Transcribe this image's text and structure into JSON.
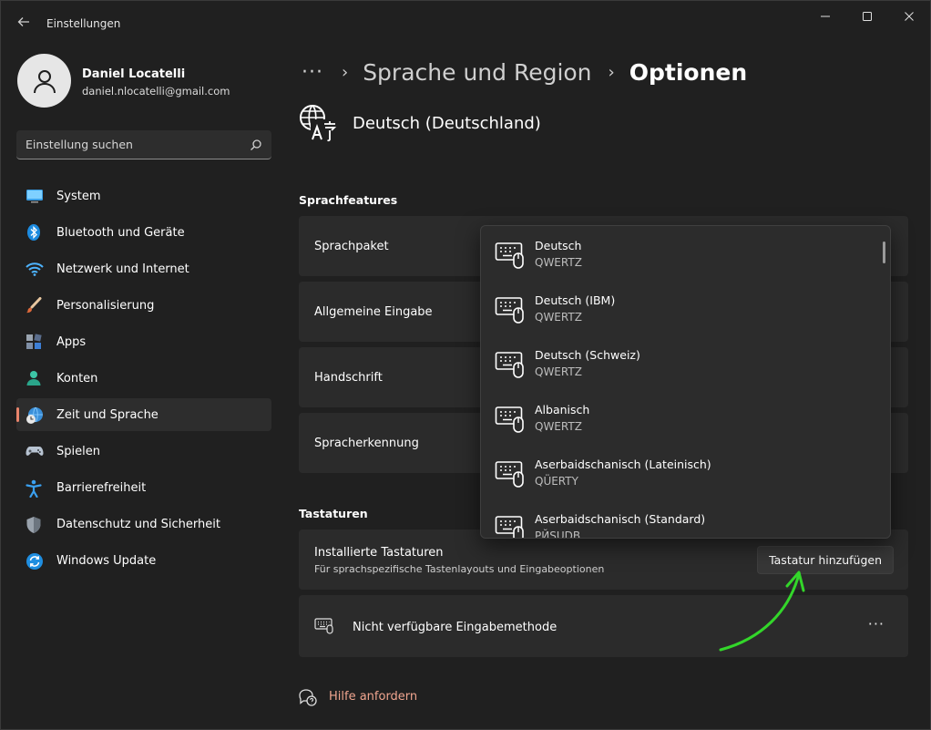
{
  "window": {
    "title": "Einstellungen",
    "controls": [
      "minimize-icon",
      "maximize-icon",
      "close-icon"
    ]
  },
  "profile": {
    "name": "Daniel Locatelli",
    "email": "daniel.nlocatelli@gmail.com"
  },
  "search": {
    "placeholder": "Einstellung suchen"
  },
  "nav": {
    "active": "Zeit und Sprache",
    "items": [
      {
        "label": "System",
        "icon": "monitor-icon"
      },
      {
        "label": "Bluetooth und Geräte",
        "icon": "bluetooth-icon"
      },
      {
        "label": "Netzwerk und Internet",
        "icon": "wifi-icon"
      },
      {
        "label": "Personalisierung",
        "icon": "brush-icon"
      },
      {
        "label": "Apps",
        "icon": "apps-icon"
      },
      {
        "label": "Konten",
        "icon": "person-icon"
      },
      {
        "label": "Zeit und Sprache",
        "icon": "clock-globe-icon"
      },
      {
        "label": "Spielen",
        "icon": "gamepad-icon"
      },
      {
        "label": "Barrierefreiheit",
        "icon": "accessibility-icon"
      },
      {
        "label": "Datenschutz und Sicherheit",
        "icon": "shield-icon"
      },
      {
        "label": "Windows Update",
        "icon": "update-icon"
      }
    ]
  },
  "breadcrumb": {
    "parent": "Sprache und Region",
    "current": "Optionen"
  },
  "language": {
    "title": "Deutsch (Deutschland)"
  },
  "sprachfeatures": {
    "title": "Sprachfeatures",
    "items": [
      "Sprachpaket",
      "Allgemeine Eingabe",
      "Handschrift",
      "Spracherkennung"
    ]
  },
  "tastaturen": {
    "title": "Tastaturen",
    "installed_label": "Installierte Tastaturen",
    "installed_sub": "Für sprachspezifische Tastenlayouts und Eingabeoptionen",
    "add_button": "Tastatur hinzufügen",
    "unavailable_label": "Nicht verfügbare Eingabemethode",
    "more": "···"
  },
  "help": {
    "label": "Hilfe anfordern"
  },
  "keyboard_flyout": {
    "items": [
      {
        "name": "Deutsch",
        "layout": "QWERTZ"
      },
      {
        "name": "Deutsch (IBM)",
        "layout": "QWERTZ"
      },
      {
        "name": "Deutsch (Schweiz)",
        "layout": "QWERTZ"
      },
      {
        "name": "Albanisch",
        "layout": "QWERTZ"
      },
      {
        "name": "Aserbaidschanisch (Lateinisch)",
        "layout": "QÜERTY"
      },
      {
        "name": "Aserbaidschanisch (Standard)",
        "layout": "РЙSUDB"
      }
    ]
  },
  "colors": {
    "accent": "#e8846b",
    "background": "#202020",
    "card": "#2b2b2b",
    "annotation_arrow": "#33d62a"
  }
}
